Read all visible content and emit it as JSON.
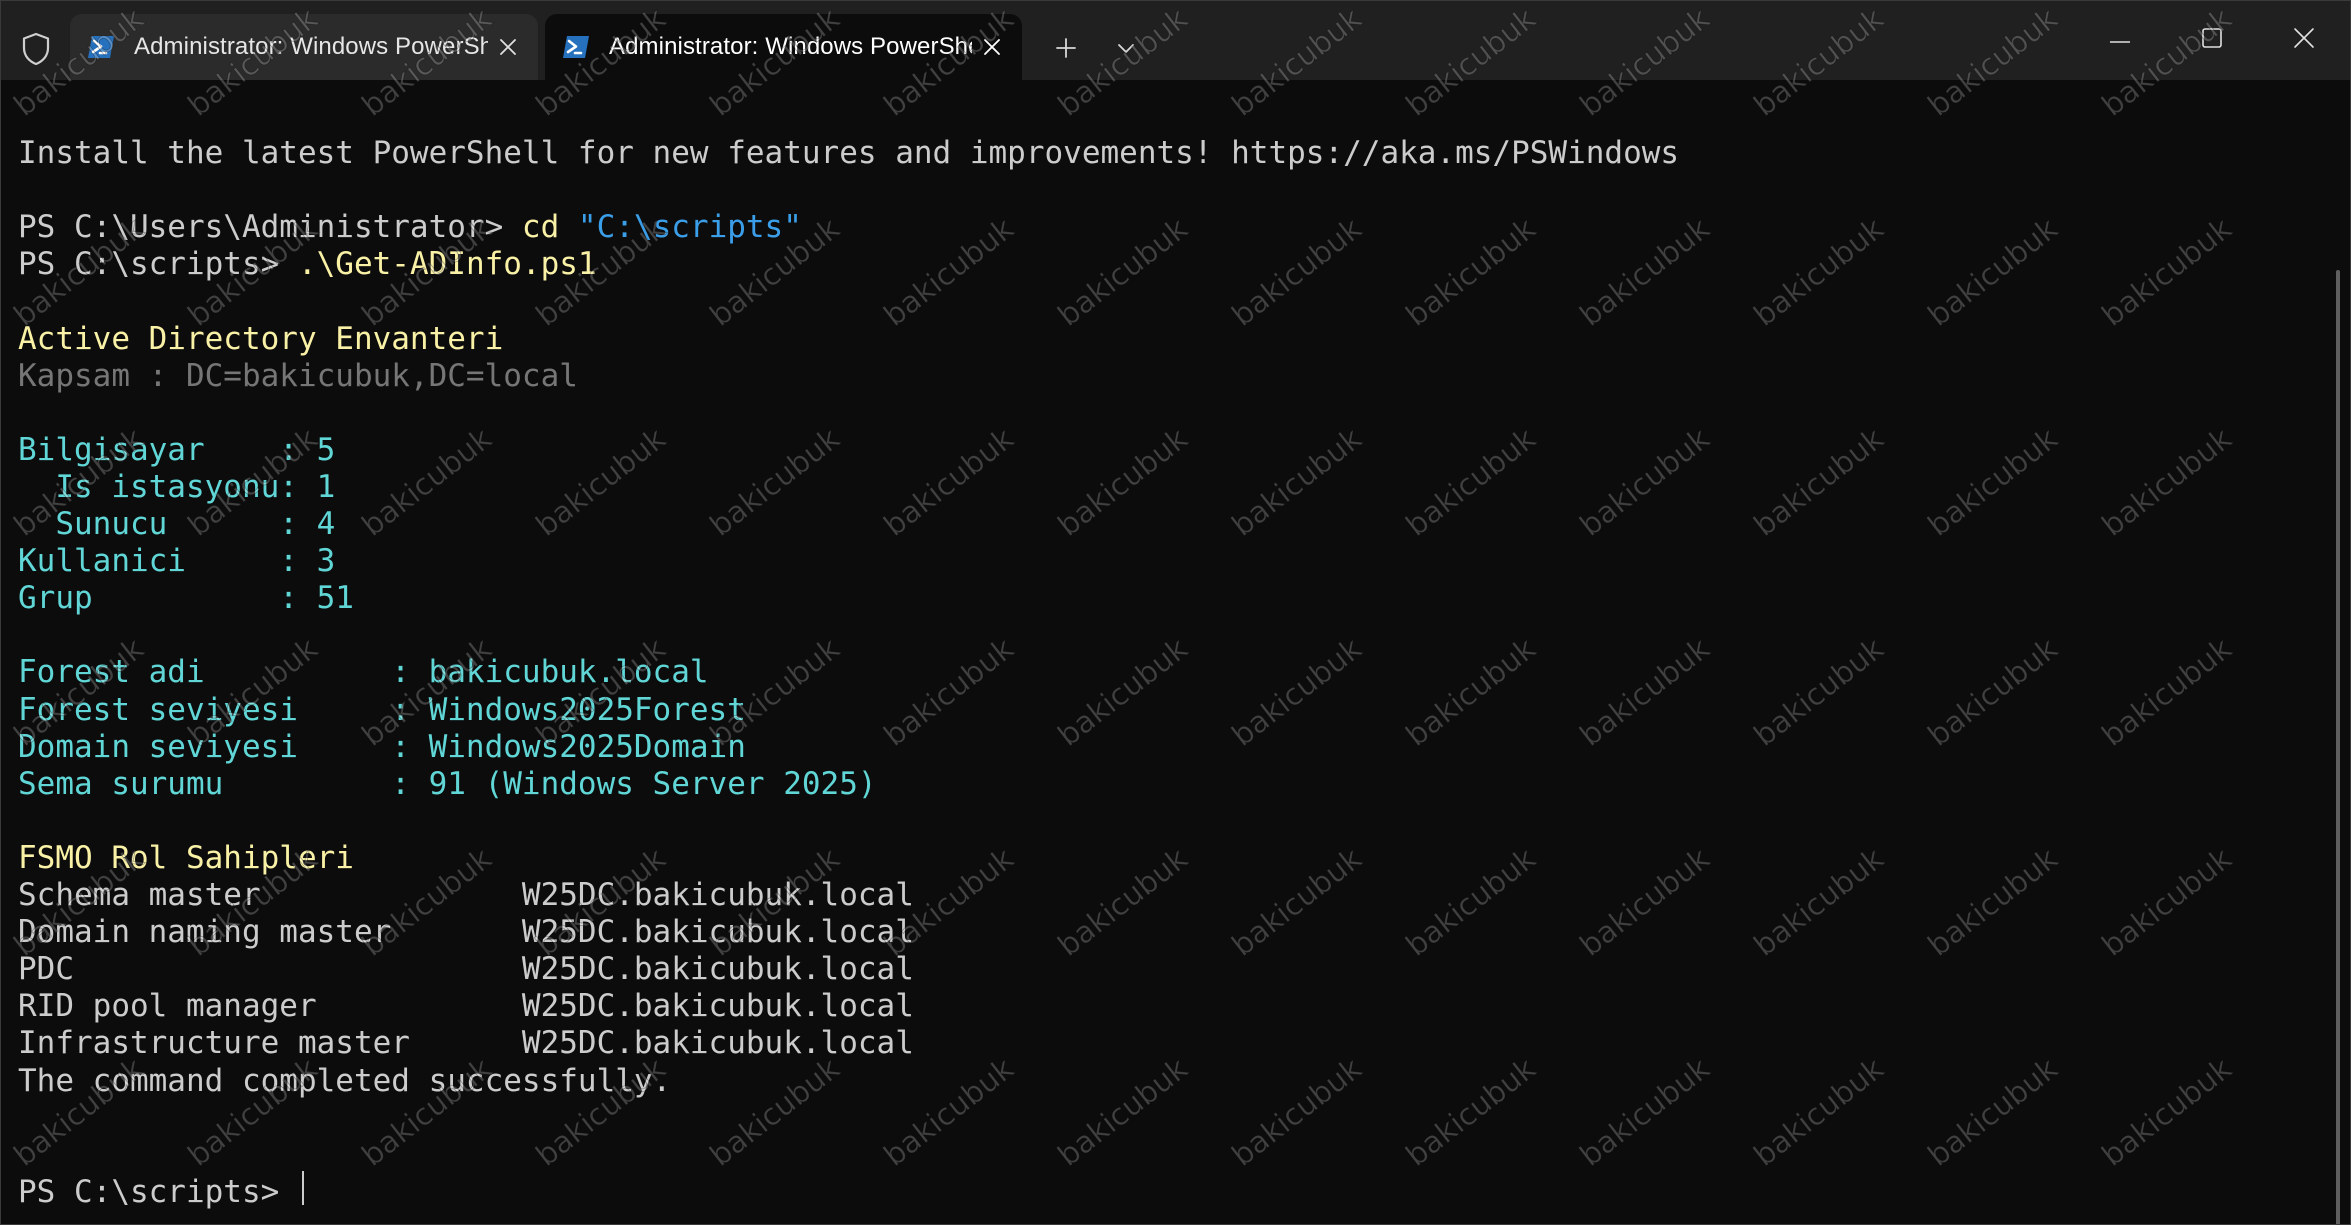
{
  "titlebar": {
    "tabs": [
      {
        "title": "Administrator: Windows PowerShell",
        "active": false
      },
      {
        "title": "Administrator: Windows PowerShell",
        "active": true
      }
    ],
    "icons": {
      "shield": "shield-icon",
      "tab_app": "powershell-icon",
      "tab_close": "close-icon",
      "new_tab": "plus-icon",
      "dropdown": "chevron-down-icon",
      "minimize": "minimize-icon",
      "maximize": "maximize-icon",
      "close": "close-icon"
    }
  },
  "colors": {
    "white": "#cccccc",
    "yellow": "#f9f1a5",
    "blue": "#3b9ee8",
    "cyan": "#61d6d6",
    "gray": "#767676"
  },
  "terminal": {
    "lines": [
      [
        {
          "text": "Install the latest PowerShell for new features and improvements! https://aka.ms/PSWindows",
          "color": "#cccccc"
        }
      ],
      [],
      [
        {
          "text": "PS C:\\Users\\Administrator> ",
          "color": "#cccccc"
        },
        {
          "text": "cd",
          "color": "#f9f1a5"
        },
        {
          "text": " ",
          "color": "#cccccc"
        },
        {
          "text": "\"C:\\scripts\"",
          "color": "#3b9ee8"
        }
      ],
      [
        {
          "text": "PS C:\\scripts> ",
          "color": "#cccccc"
        },
        {
          "text": ".\\Get-ADInfo.ps1",
          "color": "#f9f1a5"
        }
      ],
      [],
      [
        {
          "text": "Active Directory Envanteri",
          "color": "#f9f1a5"
        }
      ],
      [
        {
          "text": "Kapsam : DC=bakicubuk,DC=local",
          "color": "#767676"
        }
      ],
      [],
      [
        {
          "text": "Bilgisayar    : 5",
          "color": "#61d6d6"
        }
      ],
      [
        {
          "text": "  Is istasyonu: 1",
          "color": "#61d6d6"
        }
      ],
      [
        {
          "text": "  Sunucu      : 4",
          "color": "#61d6d6"
        }
      ],
      [
        {
          "text": "Kullanici     : 3",
          "color": "#61d6d6"
        }
      ],
      [
        {
          "text": "Grup          : 51",
          "color": "#61d6d6"
        }
      ],
      [],
      [
        {
          "text": "Forest adi          : bakicubuk.local",
          "color": "#61d6d6"
        }
      ],
      [
        {
          "text": "Forest seviyesi     : Windows2025Forest",
          "color": "#61d6d6"
        }
      ],
      [
        {
          "text": "Domain seviyesi     : Windows2025Domain",
          "color": "#61d6d6"
        }
      ],
      [
        {
          "text": "Sema surumu         : 91 (Windows Server 2025)",
          "color": "#61d6d6"
        }
      ],
      [],
      [
        {
          "text": "FSMO Rol Sahipleri",
          "color": "#f9f1a5"
        }
      ],
      [
        {
          "text": "Schema master              W25DC.bakicubuk.local",
          "color": "#cccccc"
        }
      ],
      [
        {
          "text": "Domain naming master       W25DC.bakicubuk.local",
          "color": "#cccccc"
        }
      ],
      [
        {
          "text": "PDC                        W25DC.bakicubuk.local",
          "color": "#cccccc"
        }
      ],
      [
        {
          "text": "RID pool manager           W25DC.bakicubuk.local",
          "color": "#cccccc"
        }
      ],
      [
        {
          "text": "Infrastructure master      W25DC.bakicubuk.local",
          "color": "#cccccc"
        }
      ],
      [
        {
          "text": "The command completed successfully.",
          "color": "#cccccc"
        }
      ],
      [],
      [],
      [
        {
          "text": "PS C:\\scripts> ",
          "color": "#cccccc"
        }
      ]
    ]
  },
  "watermark": {
    "text": "bakicubuk"
  }
}
